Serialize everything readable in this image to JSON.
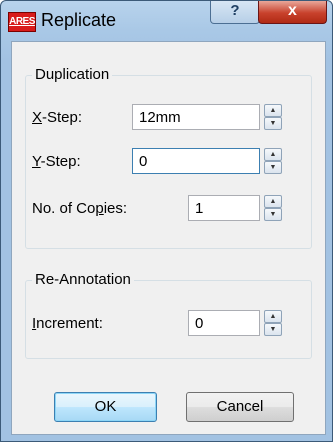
{
  "window": {
    "app_icon_text": "ARES",
    "title": "Replicate",
    "help_glyph": "?",
    "close_glyph": "x"
  },
  "duplication": {
    "group_title": "Duplication",
    "x_step": {
      "label_mnemonic": "X",
      "label_rest": "-Step:",
      "value": "12mm"
    },
    "y_step": {
      "label_mnemonic": "Y",
      "label_rest": "-Step:",
      "value": "0"
    },
    "copies": {
      "label_before": "No. of Co",
      "label_mnemonic": "p",
      "label_after": "ies:",
      "value": "1"
    }
  },
  "reannotation": {
    "group_title": "Re-Annotation",
    "increment": {
      "label_mnemonic": "I",
      "label_rest": "ncrement:",
      "value": "0"
    }
  },
  "buttons": {
    "ok": "OK",
    "cancel": "Cancel"
  },
  "icons": {
    "spin_up": "up-arrow-icon",
    "spin_down": "down-arrow-icon"
  },
  "colors": {
    "titlebar": "#a9c8e6",
    "close": "#c8412c",
    "app_icon": "#d81b1b",
    "focus": "#3c7fb1"
  }
}
